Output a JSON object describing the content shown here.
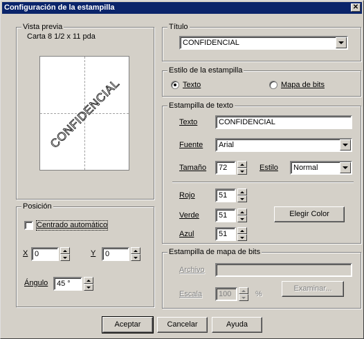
{
  "window": {
    "title": "Configuración de la estampilla",
    "close_glyph": "✕"
  },
  "preview": {
    "legend": "Vista previa",
    "paper": "Carta 8 1/2 x 11 pda",
    "stamp_text": "CONFIDENCIAL",
    "stamp_angle_deg": 45
  },
  "title_group": {
    "legend": "Título",
    "selected": "CONFIDENCIAL"
  },
  "style_group": {
    "legend": "Estilo de la estampilla",
    "text_label": "Texto",
    "bitmap_label": "Mapa de bits",
    "selected": "Texto"
  },
  "text_group": {
    "legend": "Estampilla de texto",
    "text_label": "Texto",
    "text_value": "CONFIDENCIAL",
    "font_label": "Fuente",
    "font_value": "Arial",
    "size_label": "Tamaño",
    "size_value": "72",
    "style_label": "Estilo",
    "style_value": "Normal",
    "red_label": "Rojo",
    "red_value": "51",
    "green_label": "Verde",
    "green_value": "51",
    "blue_label": "Azul",
    "blue_value": "51",
    "color_button": "Elegir Color"
  },
  "position_group": {
    "legend": "Posición",
    "auto_center_label": "Centrado automático",
    "auto_center_checked": false,
    "x_label": "X",
    "x_value": "0",
    "y_label": "Y",
    "y_value": "0",
    "angle_label": "Ángulo",
    "angle_value": "45 °"
  },
  "bitmap_group": {
    "legend": "Estampilla de mapa de bits",
    "file_label": "Archivo",
    "file_value": "",
    "scale_label": "Escala",
    "scale_value": "100",
    "scale_unit": "%",
    "browse_button": "Examinar..."
  },
  "footer": {
    "ok": "Aceptar",
    "cancel": "Cancelar",
    "help": "Ayuda"
  }
}
